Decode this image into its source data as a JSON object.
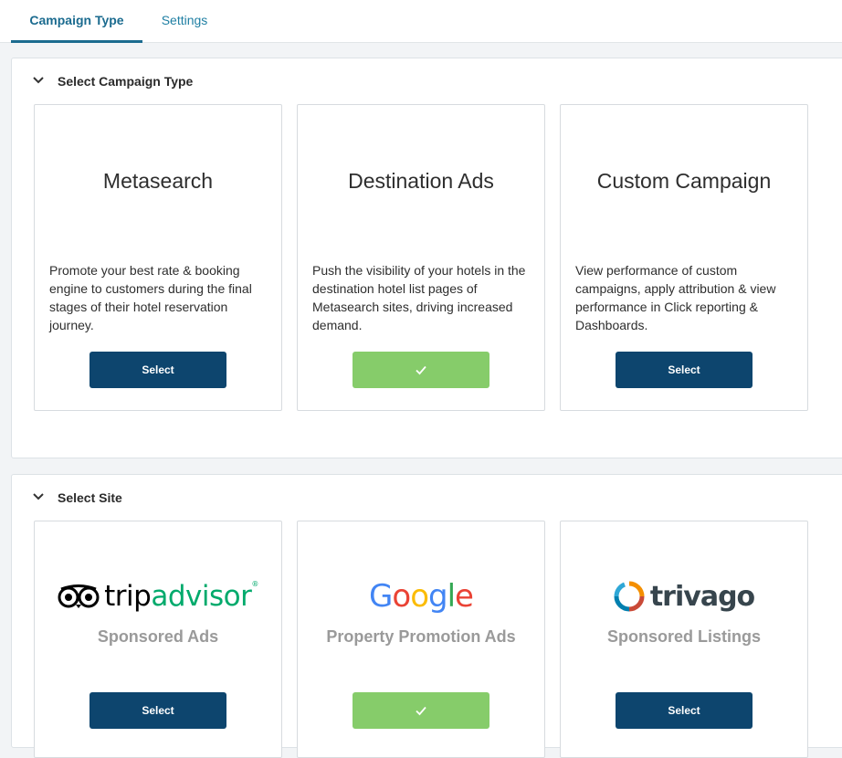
{
  "tabs": [
    {
      "label": "Campaign Type"
    },
    {
      "label": "Settings"
    }
  ],
  "campaign_section": {
    "title": "Select Campaign Type",
    "cards": [
      {
        "title": "Metasearch",
        "description": "Promote your best rate & booking engine to customers during the final stages of their hotel reservation journey.",
        "button": "Select",
        "state": "unselected"
      },
      {
        "title": "Destination Ads",
        "description": "Push the visibility of your hotels in the destination hotel list pages of Metasearch sites, driving increased demand.",
        "button": "",
        "state": "selected"
      },
      {
        "title": "Custom Campaign",
        "description": "View performance of custom campaigns, apply attribution & view performance in Click reporting & Dashboards.",
        "button": "Select",
        "state": "unselected"
      }
    ]
  },
  "site_section": {
    "title": "Select Site",
    "cards": [
      {
        "logo_name": "tripadvisor-logo",
        "logo_text_a": "trip",
        "logo_text_b": "advisor",
        "logo_mark": "®",
        "name": "Sponsored Ads",
        "button": "Select",
        "state": "unselected"
      },
      {
        "logo_name": "google-logo",
        "logo_text": "Google",
        "name": "Property Promotion Ads",
        "button": "",
        "state": "selected"
      },
      {
        "logo_name": "trivago-logo",
        "logo_text": "trivago",
        "name": "Sponsored Listings",
        "button": "Select",
        "state": "unselected"
      }
    ]
  },
  "colors": {
    "primary_button": "#0d456e",
    "selected_button": "#86cc6a",
    "tab_active": "#1b6b8f"
  },
  "icons": {
    "section_toggle": "chevron-down-icon",
    "selected": "check-icon"
  }
}
